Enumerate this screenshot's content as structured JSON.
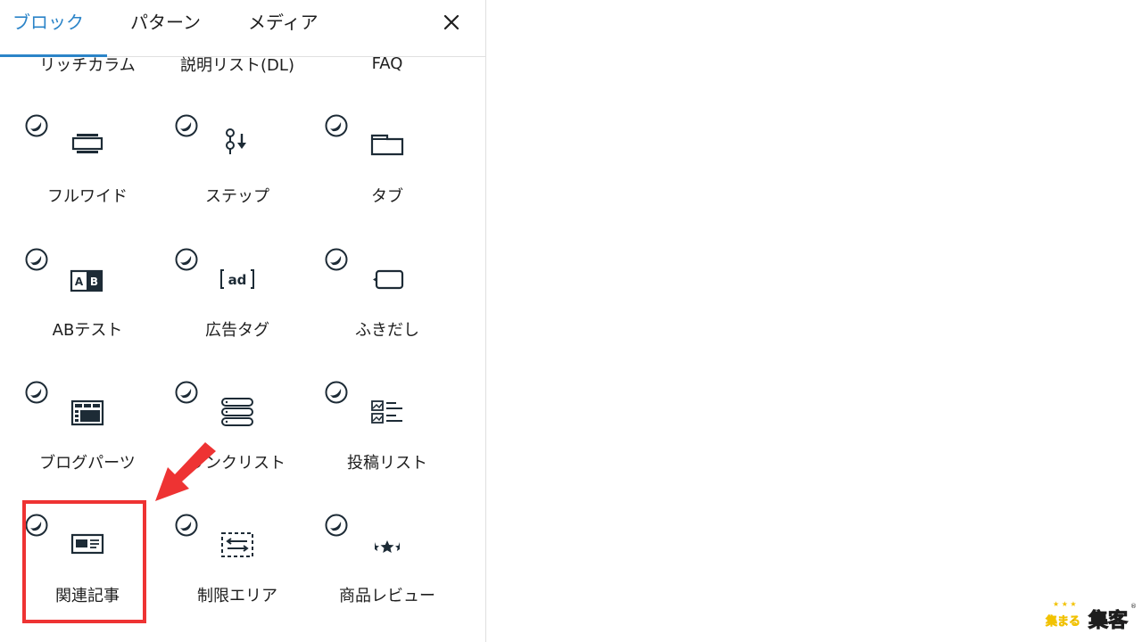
{
  "tabs": [
    {
      "label": "ブロック",
      "active": true
    },
    {
      "label": "パターン",
      "active": false
    },
    {
      "label": "メディア",
      "active": false
    }
  ],
  "close_icon": "close-icon",
  "top_row": [
    "リッチカラム",
    "説明リスト(DL)",
    "FAQ"
  ],
  "blocks": [
    {
      "label": "フルワイド",
      "icon": "fullwide-icon"
    },
    {
      "label": "ステップ",
      "icon": "step-icon"
    },
    {
      "label": "タブ",
      "icon": "tab-icon"
    },
    {
      "label": "ABテスト",
      "icon": "ab-test-icon"
    },
    {
      "label": "広告タグ",
      "icon": "ad-tag-icon"
    },
    {
      "label": "ふきだし",
      "icon": "balloon-icon"
    },
    {
      "label": "ブログパーツ",
      "icon": "blog-parts-icon"
    },
    {
      "label": "リンクリスト",
      "icon": "link-list-icon"
    },
    {
      "label": "投稿リスト",
      "icon": "post-list-icon"
    },
    {
      "label": "関連記事",
      "icon": "related-posts-icon"
    },
    {
      "label": "制限エリア",
      "icon": "restricted-area-icon"
    },
    {
      "label": "商品レビュー",
      "icon": "product-review-icon"
    }
  ],
  "colors": {
    "accent": "#2b84c8",
    "highlight": "#ee3333",
    "icon": "#1d2b36",
    "text": "#1e1e1e"
  },
  "logo": {
    "text": "集まる集客"
  }
}
